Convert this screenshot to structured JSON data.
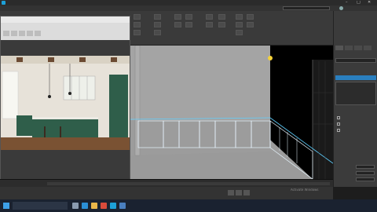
{
  "app": {
    "title": "",
    "window_controls": [
      "–",
      "□",
      "✕"
    ]
  },
  "menubar": {
    "items": [
      "",
      "",
      "",
      "",
      "",
      "",
      "",
      "",
      "",
      "",
      "",
      "",
      "",
      "",
      "",
      ""
    ]
  },
  "ribbon": {
    "groups": [
      "",
      "",
      "",
      "",
      ""
    ]
  },
  "render_window": {
    "title": "",
    "menu": [
      "",
      "",
      "",
      "",
      ""
    ]
  },
  "viewport": {
    "label": ""
  },
  "command_panel": {
    "tabs": [
      "",
      "",
      "",
      ""
    ],
    "sections": [
      "",
      "",
      ""
    ]
  },
  "timeline": {
    "frame_label": ""
  },
  "statusbar": {
    "text": "",
    "watermark": "Activate Windows"
  },
  "taskbar": {
    "clock": "",
    "date": ""
  },
  "colors": {
    "viewport_bg": "#9c9c9c",
    "render_dark_wall": "#000000",
    "cabinet_green": "#2f5e4a",
    "selection_blue": "#5fd0ff",
    "taskbar_bg": "#1a2230"
  }
}
